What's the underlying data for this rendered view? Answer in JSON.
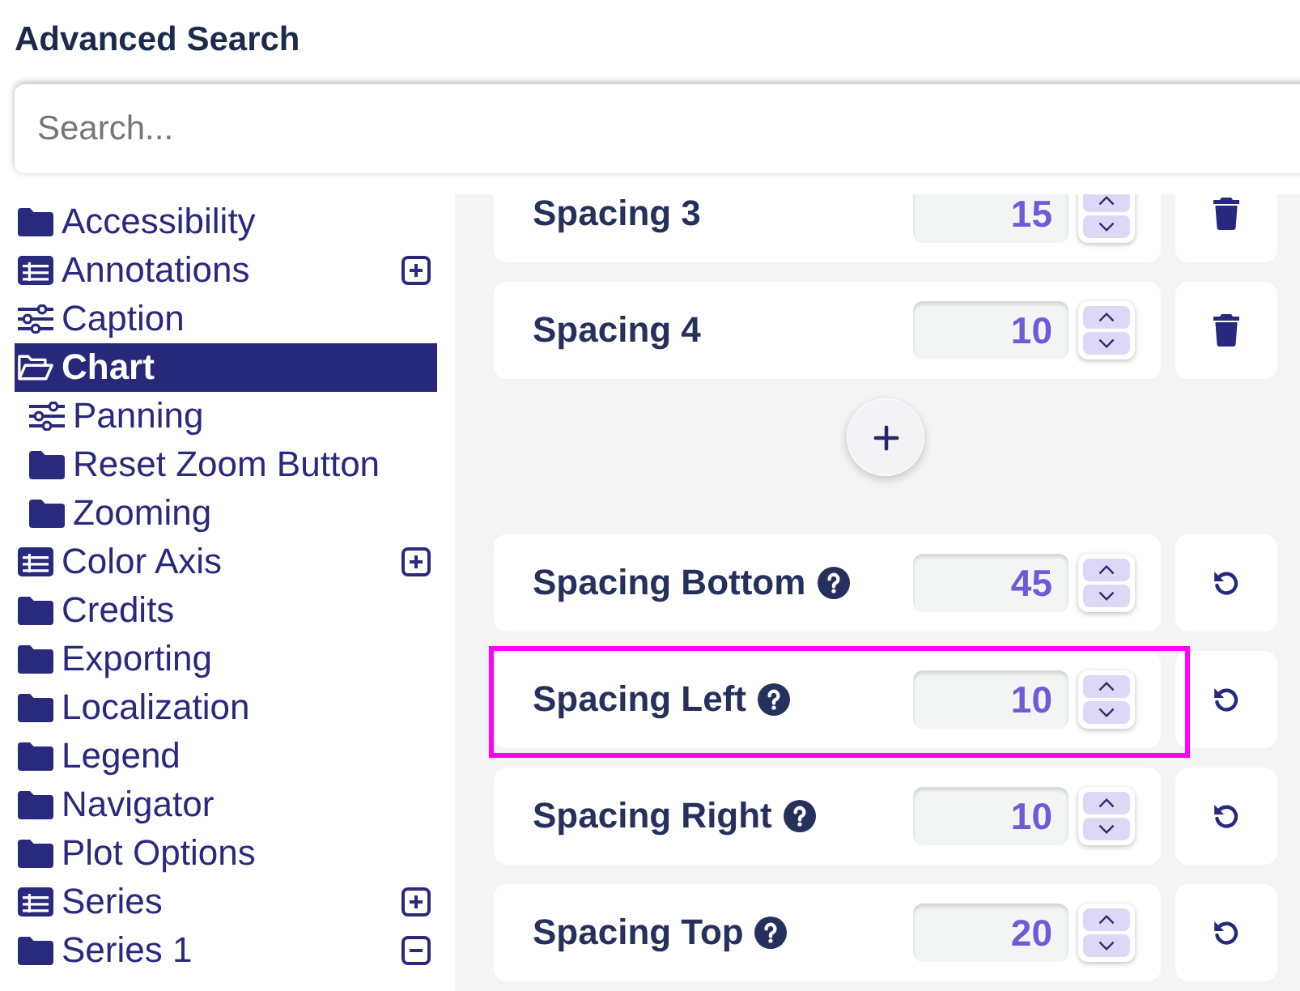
{
  "header": {
    "title": "Advanced Search"
  },
  "search": {
    "placeholder": "Search..."
  },
  "sidebar": {
    "items": [
      {
        "label": "Accessibility",
        "kind": "folder",
        "selected": false
      },
      {
        "label": "Annotations",
        "kind": "table",
        "selected": false,
        "expanded": false
      },
      {
        "label": "Caption",
        "kind": "sliders",
        "selected": false
      },
      {
        "label": "Chart",
        "kind": "folder-open",
        "selected": true,
        "children": [
          {
            "label": "Panning",
            "kind": "sliders",
            "selected": false
          },
          {
            "label": "Reset Zoom Button",
            "kind": "folder",
            "selected": false
          },
          {
            "label": "Zooming",
            "kind": "folder",
            "selected": false
          }
        ]
      },
      {
        "label": "Color Axis",
        "kind": "table",
        "selected": false,
        "expanded": false
      },
      {
        "label": "Credits",
        "kind": "folder",
        "selected": false
      },
      {
        "label": "Exporting",
        "kind": "folder",
        "selected": false
      },
      {
        "label": "Localization",
        "kind": "folder",
        "selected": false
      },
      {
        "label": "Legend",
        "kind": "folder",
        "selected": false
      },
      {
        "label": "Navigator",
        "kind": "folder",
        "selected": false
      },
      {
        "label": "Plot Options",
        "kind": "folder",
        "selected": false
      },
      {
        "label": "Series",
        "kind": "table",
        "selected": false,
        "expanded": false
      },
      {
        "label": "Series 1",
        "kind": "folder",
        "selected": false,
        "expanded": true
      }
    ]
  },
  "settings": {
    "custom_spacings": [
      {
        "label": "Spacing 3",
        "value": "15",
        "help": false,
        "kind": "delete",
        "highlighted": false
      },
      {
        "label": "Spacing 4",
        "value": "10",
        "help": false,
        "kind": "delete",
        "highlighted": false
      }
    ],
    "options": [
      {
        "label": "Spacing Bottom",
        "value": "45",
        "help": true,
        "kind": "reset",
        "highlighted": false
      },
      {
        "label": "Spacing Left",
        "value": "10",
        "help": true,
        "kind": "reset",
        "highlighted": true
      },
      {
        "label": "Spacing Right",
        "value": "10",
        "help": true,
        "kind": "reset",
        "highlighted": false
      },
      {
        "label": "Spacing Top",
        "value": "20",
        "help": true,
        "kind": "reset",
        "highlighted": false
      }
    ]
  }
}
